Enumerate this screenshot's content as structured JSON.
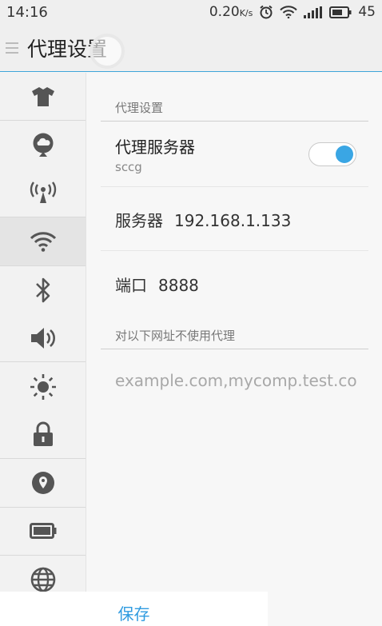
{
  "status": {
    "time": "14:16",
    "speed": "0.20",
    "speed_unit": "K/s",
    "battery": "45"
  },
  "appbar": {
    "title": "代理设置"
  },
  "sidebar": {
    "items": [
      "shirt-icon",
      "cloud-icon",
      "antenna-icon",
      "wifi-icon",
      "bluetooth-icon",
      "volume-icon",
      "brightness-icon",
      "lock-icon",
      "location-icon",
      "battery-icon",
      "globe-icon"
    ]
  },
  "content": {
    "section_title": "代理设置",
    "proxy": {
      "title": "代理服务器",
      "subtitle": "sccg",
      "enabled": true
    },
    "server": {
      "label": "服务器",
      "value": "192.168.1.133"
    },
    "port": {
      "label": "端口",
      "value": "8888"
    },
    "exclude": {
      "label": "对以下网址不使用代理",
      "placeholder": "example.com,mycomp.test.co"
    }
  },
  "footer": {
    "save_label": "保存"
  },
  "colors": {
    "accent": "#3aa6e4",
    "divider": "#3ea5d9"
  }
}
